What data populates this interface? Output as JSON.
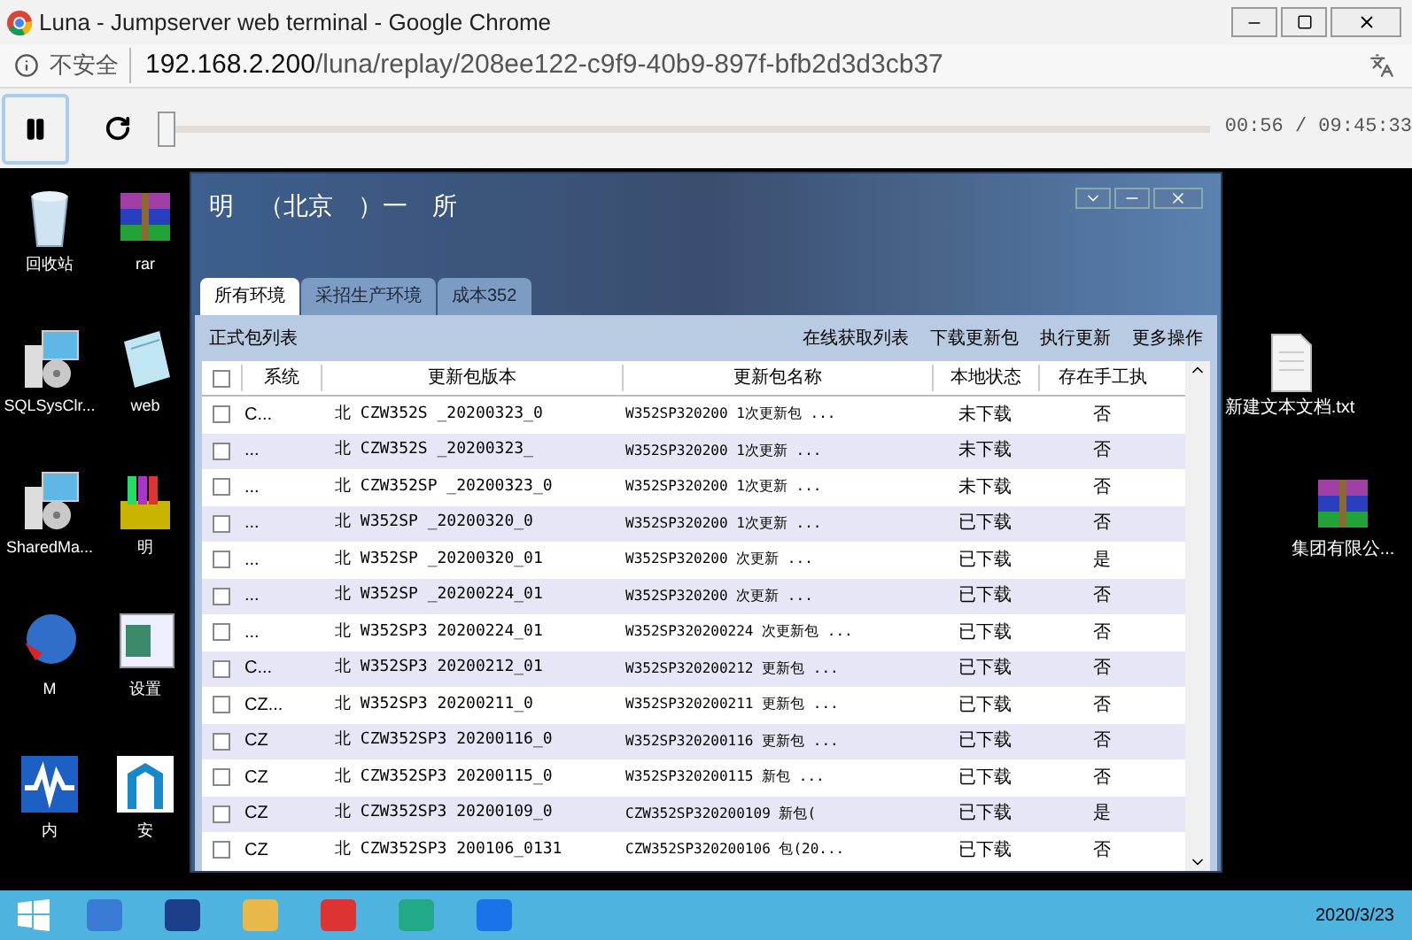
{
  "window": {
    "title": "Luna - Jumpserver web terminal - Google Chrome"
  },
  "address_bar": {
    "security": "不安全",
    "url_host": "192.168.2.200",
    "url_path": "/luna/replay/208ee122-c9f9-40b9-897f-bfb2d3d3cb37"
  },
  "player": {
    "playing": true,
    "level": 0.0,
    "time": "00:56 / 09:45:33"
  },
  "desktop_icons": [
    {
      "label": "回收站",
      "kind": "bin"
    },
    {
      "label": "rar",
      "kind": "archive"
    },
    {
      "label": "SQLSysClr...",
      "kind": "installer"
    },
    {
      "label": "web",
      "kind": "note"
    },
    {
      "label": "SharedMa...",
      "kind": "installer"
    },
    {
      "label": "明",
      "kind": "books"
    },
    {
      "label": "M",
      "kind": "globe"
    },
    {
      "label": "设置",
      "kind": "screen"
    },
    {
      "label": "内",
      "kind": "wave"
    },
    {
      "label": "安",
      "kind": "door"
    }
  ],
  "desktop_icons_right": [
    {
      "label": "新建文本文档.txt",
      "kind": "text"
    },
    {
      "label": "集团有限公...",
      "kind": "archive"
    }
  ],
  "app": {
    "title_parts": [
      "明",
      "（北京",
      "）一",
      "所"
    ],
    "tabs": [
      {
        "label": "所有环境",
        "selected": true
      },
      {
        "label": "采招生产环境",
        "selected": false
      },
      {
        "label": "成本352",
        "selected": false
      }
    ],
    "list_title": "正式包列表",
    "actions": [
      "在线获取列表",
      "下载更新包",
      "执行更新",
      "更多操作"
    ],
    "table": {
      "header_checked": false,
      "columns": [
        "系统",
        "更新包版本",
        "更新包名称",
        "本地状态",
        "存在手工执"
      ],
      "rows": [
        {
          "checked": false,
          "system": "C...",
          "version": "北 CZW352S _20200323_0",
          "name": "W352SP320200 1次更新包 ...",
          "status": "未下载",
          "manual": "否"
        },
        {
          "checked": false,
          "system": "...",
          "version": "北 CZW352S _20200323_",
          "name": "W352SP320200 1次更新 ...",
          "status": "未下载",
          "manual": "否"
        },
        {
          "checked": false,
          "system": "...",
          "version": "北 CZW352SP _20200323_0",
          "name": "W352SP320200 1次更新 ...",
          "status": "未下载",
          "manual": "否"
        },
        {
          "checked": false,
          "system": "...",
          "version": "北 W352SP _20200320_0",
          "name": "W352SP320200 1次更新 ...",
          "status": "已下载",
          "manual": "否"
        },
        {
          "checked": false,
          "system": "...",
          "version": "北 W352SP _20200320_01",
          "name": "W352SP320200 次更新 ...",
          "status": "已下载",
          "manual": "是"
        },
        {
          "checked": false,
          "system": "...",
          "version": "北 W352SP _20200224_01",
          "name": "W352SP320200 次更新 ...",
          "status": "已下载",
          "manual": "否"
        },
        {
          "checked": false,
          "system": "...",
          "version": "北 W352SP3 20200224_01",
          "name": "W352SP320200224 次更新包 ...",
          "status": "已下载",
          "manual": "否"
        },
        {
          "checked": false,
          "system": "C...",
          "version": "北 W352SP3 20200212_01",
          "name": "W352SP320200212 更新包 ...",
          "status": "已下载",
          "manual": "否"
        },
        {
          "checked": false,
          "system": "CZ...",
          "version": "北 W352SP3 20200211_0",
          "name": "W352SP320200211 更新包 ...",
          "status": "已下载",
          "manual": "否"
        },
        {
          "checked": false,
          "system": "CZ",
          "version": "北 CZW352SP3 20200116_0",
          "name": "W352SP320200116 更新包 ...",
          "status": "已下载",
          "manual": "否"
        },
        {
          "checked": false,
          "system": "CZ",
          "version": "北 CZW352SP3 20200115_0",
          "name": "W352SP320200115 新包 ...",
          "status": "已下载",
          "manual": "否"
        },
        {
          "checked": false,
          "system": "CZ",
          "version": "北 CZW352SP3 20200109_0",
          "name": "CZW352SP320200109 新包(",
          "status": "已下载",
          "manual": "是"
        },
        {
          "checked": false,
          "system": "CZ",
          "version": "北 CZW352SP3 200106_0131",
          "name": "CZW352SP320200106 包(20...",
          "status": "已下载",
          "manual": "否"
        }
      ]
    }
  },
  "taskbar": {
    "date": "2020/3/23"
  }
}
